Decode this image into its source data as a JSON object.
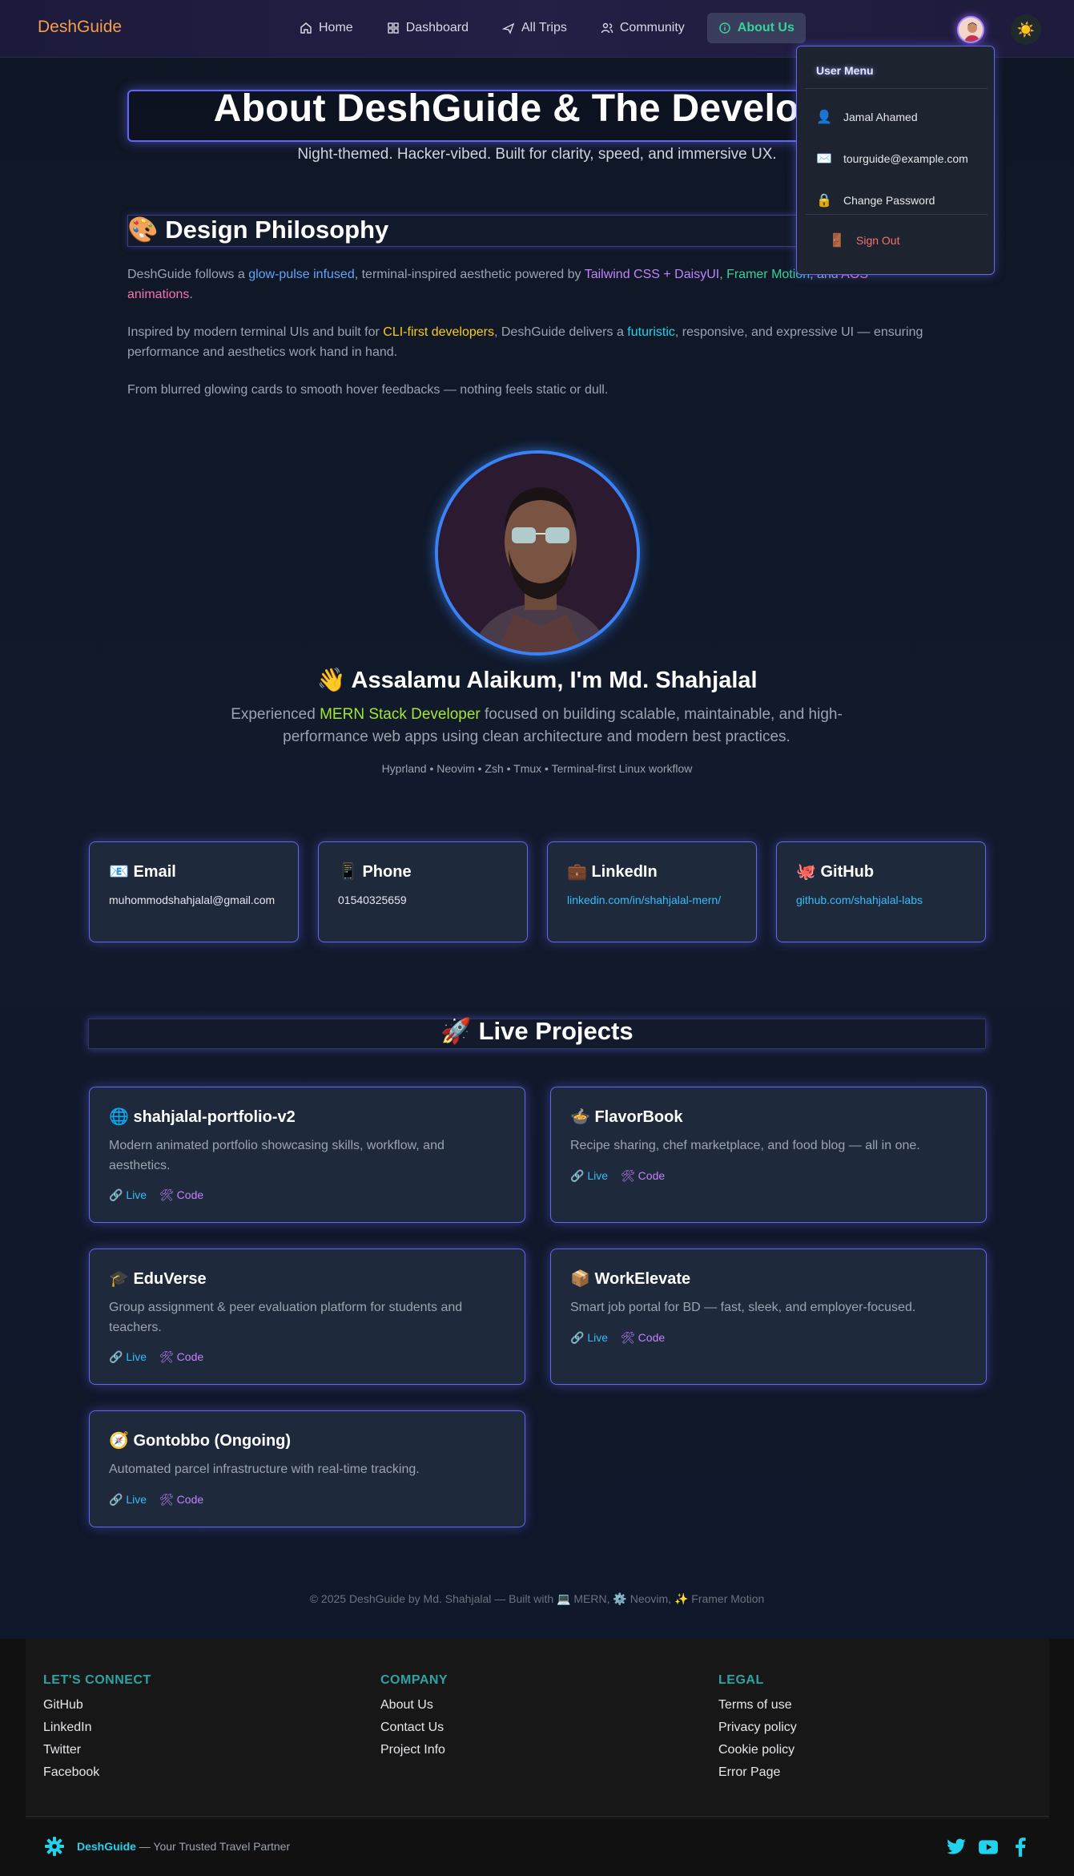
{
  "nav": {
    "brand": "DeshGuide",
    "links": [
      {
        "label": "Home",
        "icon": "home-icon"
      },
      {
        "label": "Dashboard",
        "icon": "dashboard-icon"
      },
      {
        "label": "All Trips",
        "icon": "plane-icon"
      },
      {
        "label": "Community",
        "icon": "users-icon"
      },
      {
        "label": "About Us",
        "icon": "info-icon",
        "active": true
      }
    ],
    "theme_toggle_icon": "☀️"
  },
  "user_menu": {
    "title": "User Menu",
    "name": "Jamal Ahamed",
    "email": "tourguide@example.com",
    "change_password": "Change Password",
    "sign_out": "Sign Out",
    "icons": {
      "name": "👤",
      "email": "✉️",
      "password": "🔒",
      "signout": "🚪"
    }
  },
  "hero": {
    "title": "About DeshGuide & The Developer",
    "subtitle": "Night-themed. Hacker-vibed. Built for clarity, speed, and immersive UX."
  },
  "philosophy": {
    "title": "🎨 Design Philosophy",
    "p1": {
      "a": "DeshGuide follows a ",
      "b": "glow-pulse infused",
      "c": ", terminal-inspired aesthetic powered by ",
      "d": "Tailwind CSS + DaisyUI",
      "e": ", ",
      "f": "Framer Motion",
      "g": ", and ",
      "h": "AOS animations",
      "i": "."
    },
    "p2": {
      "a": "Inspired by modern terminal UIs and built for ",
      "b": "CLI-first developers",
      "c": ", DeshGuide delivers a ",
      "d": "futuristic",
      "e": ", responsive, and expressive UI — ensuring performance and aesthetics work hand in hand."
    },
    "p3": "From blurred glowing cards to smooth hover feedbacks — nothing feels static or dull."
  },
  "developer": {
    "greeting": "👋 Assalamu Alaikum, I'm Md. Shahjalal",
    "bio_a": "Experienced ",
    "bio_b": "MERN Stack Developer",
    "bio_c": " focused on building scalable, maintainable, and high-performance web apps using clean architecture and modern best practices.",
    "stack": "Hyprland • Neovim • Zsh • Tmux • Terminal-first Linux workflow"
  },
  "contacts": [
    {
      "title": "📧 Email",
      "value": "muhommodshahjalal@gmail.com",
      "link": false
    },
    {
      "title": "📱 Phone",
      "value": "01540325659",
      "link": false
    },
    {
      "title": "💼 LinkedIn",
      "value": "linkedin.com/in/shahjalal-mern/",
      "link": true
    },
    {
      "title": "🐙 GitHub",
      "value": "github.com/shahjalal-labs",
      "link": true
    }
  ],
  "projects_title": "🚀 Live Projects",
  "projects": [
    {
      "title": "🌐 shahjalal-portfolio-v2",
      "desc": "Modern animated portfolio showcasing skills, workflow, and aesthetics.",
      "live": "🔗 Live",
      "code": "🛠 Code"
    },
    {
      "title": "🍲 FlavorBook",
      "desc": "Recipe sharing, chef marketplace, and food blog — all in one.",
      "live": "🔗 Live",
      "code": "🛠 Code"
    },
    {
      "title": "🎓 EduVerse",
      "desc": "Group assignment & peer evaluation platform for students and teachers.",
      "live": "🔗 Live",
      "code": "🛠 Code"
    },
    {
      "title": "📦 WorkElevate",
      "desc": "Smart job portal for BD — fast, sleek, and employer-focused.",
      "live": "🔗 Live",
      "code": "🛠 Code"
    },
    {
      "title": "🧭 Gontobbo (Ongoing)",
      "desc": "Automated parcel infrastructure with real-time tracking.",
      "live": "🔗 Live",
      "code": "🛠 Code"
    }
  ],
  "copyright": "© 2025 DeshGuide by Md. Shahjalal — Built with 💻 MERN, ⚙️ Neovim, ✨ Framer Motion",
  "footer": {
    "connect": {
      "title": "LET'S CONNECT",
      "links": [
        "GitHub",
        "LinkedIn",
        "Twitter",
        "Facebook"
      ]
    },
    "company": {
      "title": "COMPANY",
      "links": [
        "About Us",
        "Contact Us",
        "Project Info"
      ]
    },
    "legal": {
      "title": "LEGAL",
      "links": [
        "Terms of use",
        "Privacy policy",
        "Cookie policy",
        "Error Page"
      ]
    },
    "brand": "DeshGuide",
    "tagline": " — Your Trusted Travel Partner",
    "socials": [
      "twitter-icon",
      "youtube-icon",
      "facebook-icon"
    ],
    "accent": "#22d3ee"
  }
}
